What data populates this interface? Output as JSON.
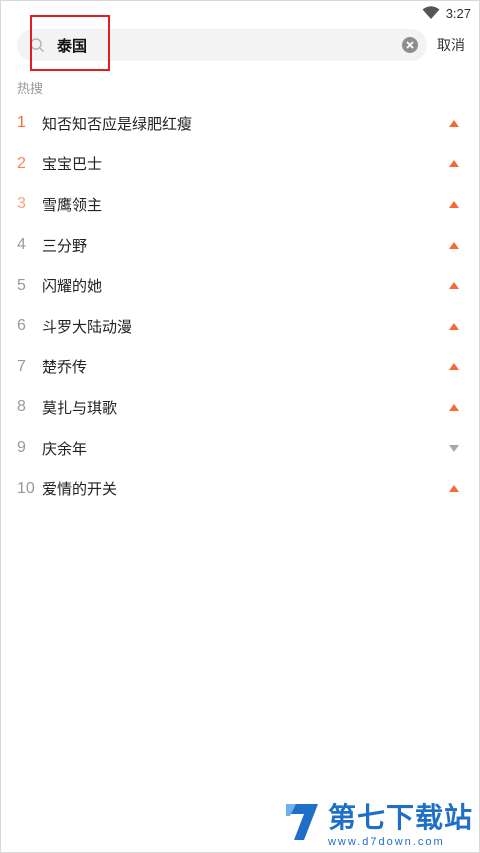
{
  "status_bar": {
    "time": "3:27",
    "wifi_icon": "wifi-icon"
  },
  "search": {
    "value": "泰国",
    "cancel_label": "取消",
    "search_icon": "search-icon",
    "clear_icon": "clear-icon"
  },
  "hot": {
    "title": "热搜",
    "items": [
      {
        "rank": "1",
        "label": "知否知否应是绿肥红瘦",
        "trend": "up"
      },
      {
        "rank": "2",
        "label": "宝宝巴士",
        "trend": "up"
      },
      {
        "rank": "3",
        "label": "雪鹰领主",
        "trend": "up"
      },
      {
        "rank": "4",
        "label": "三分野",
        "trend": "up"
      },
      {
        "rank": "5",
        "label": "闪耀的她",
        "trend": "up"
      },
      {
        "rank": "6",
        "label": "斗罗大陆动漫",
        "trend": "up"
      },
      {
        "rank": "7",
        "label": "楚乔传",
        "trend": "up"
      },
      {
        "rank": "8",
        "label": "莫扎与琪歌",
        "trend": "up"
      },
      {
        "rank": "9",
        "label": "庆余年",
        "trend": "down"
      },
      {
        "rank": "10",
        "label": "爱情的开关",
        "trend": "up"
      }
    ]
  },
  "watermark": {
    "name": "第七下载站",
    "url": "www.d7down.com"
  },
  "colors": {
    "accent": "#f26b3a",
    "highlight": "#e21e1e",
    "watermark": "#1f6fc8"
  }
}
